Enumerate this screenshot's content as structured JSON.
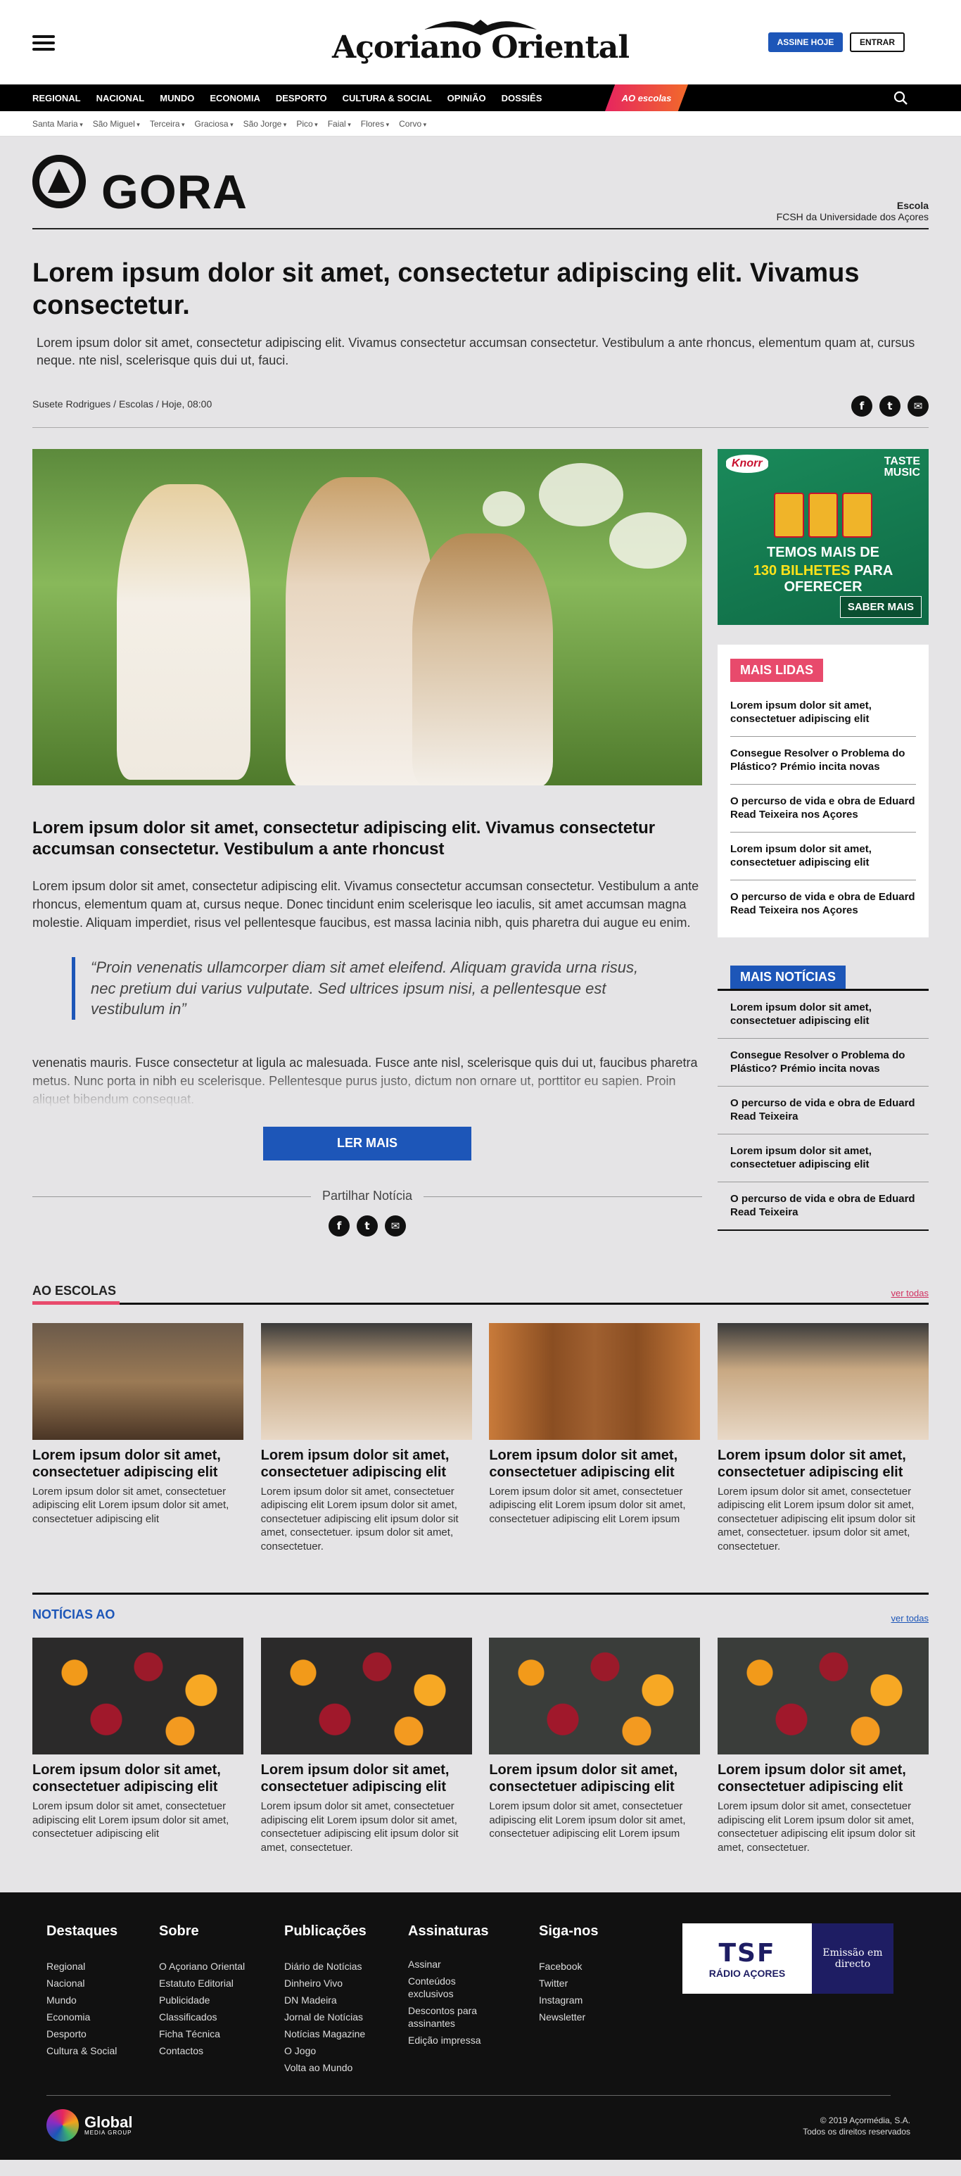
{
  "header": {
    "logo_text": "Açoriano Oriental",
    "subscribe_label": "ASSINE HOJE",
    "login_label": "ENTRAR"
  },
  "nav": {
    "items": [
      "REGIONAL",
      "NACIONAL",
      "MUNDO",
      "ECONOMIA",
      "DESPORTO",
      "CULTURA & SOCIAL",
      "OPINIÃO",
      "DOSSIÊS"
    ],
    "special": "AO escolas"
  },
  "subnav": {
    "items": [
      "Santa Maria",
      "São Miguel",
      "Terceira",
      "Graciosa",
      "São Jorge",
      "Pico",
      "Faial",
      "Flores",
      "Corvo"
    ]
  },
  "agora": {
    "wordmark": "GORA",
    "school_label": "Escola",
    "school_name": "FCSH da Universidade dos Açores"
  },
  "article": {
    "headline": "Lorem ipsum dolor sit amet, consectetur adipiscing elit. Vivamus consectetur.",
    "lead": "Lorem ipsum dolor sit amet, consectetur adipiscing elit. Vivamus consectetur accumsan consectetur. Vestibulum a ante rhoncus, elementum quam at, cursus neque. nte nisl, scelerisque quis dui ut, fauci.",
    "byline": "Susete Rodrigues / Escolas /  Hoje, 08:00",
    "subtitle": "Lorem ipsum dolor sit amet, consectetur adipiscing elit. Vivamus consectetur accumsan consectetur. Vestibulum a ante rhoncust",
    "body": "Lorem ipsum dolor sit amet, consectetur adipiscing elit. Vivamus consectetur accumsan consectetur. Vestibulum a ante rhoncus, elementum quam at, cursus neque. Donec tincidunt enim scelerisque leo iaculis, sit amet accumsan magna molestie. Aliquam imperdiet, risus vel pellentesque faucibus, est massa lacinia nibh, quis pharetra dui augue eu enim.",
    "quote": "“Proin venenatis ullamcorper diam sit amet eleifend. Aliquam gravida urna risus, nec pretium dui varius vulputate. Sed ultrices ipsum nisi, a pellentesque est vestibulum in”",
    "faded_body": "venenatis mauris. Fusce consectetur at ligula ac malesuada. Fusce ante nisl, scelerisque quis dui ut, faucibus pharetra metus. Nunc porta in nibh eu scelerisque. Pellentesque purus justo, dictum non ornare ut, porttitor eu sapien. Proin aliquet bibendum consequat.",
    "read_more": "LER MAIS",
    "share_label": "Partilhar Notícia"
  },
  "ad": {
    "brand": "Knorr",
    "tag_line1": "TASTE",
    "tag_line2": "MUSIC",
    "line1": "TEMOS MAIS DE",
    "line2_highlight": "130 BILHETES",
    "line2_rest": " PARA OFERECER",
    "cta": "SABER MAIS"
  },
  "mais_lidas": {
    "title": "MAIS LIDAS",
    "items": [
      "Lorem ipsum dolor sit amet, consectetuer adipiscing elit",
      "Consegue Resolver o Problema do Plástico? Prémio incita novas",
      "O percurso de vida e obra de Eduard Read Teixeira nos Açores",
      "Lorem ipsum dolor sit amet, consectetuer adipiscing elit",
      "O percurso de vida e obra de Eduard Read Teixeira nos Açores"
    ]
  },
  "mais_noticias": {
    "title": "MAIS NOTÍCIAS",
    "items": [
      "Lorem ipsum dolor sit amet, consectetuer adipiscing elit",
      "Consegue Resolver o Problema do Plástico? Prémio incita novas",
      "O percurso de vida e obra de Eduard Read Teixeira",
      "Lorem ipsum dolor sit amet, consectetuer adipiscing elit",
      "O percurso de vida e obra de Eduard Read Teixeira"
    ]
  },
  "ao_escolas": {
    "title": "AO ESCOLAS",
    "link": "ver todas",
    "cards": [
      {
        "title": "Lorem ipsum dolor sit amet, consectetuer adipiscing elit",
        "body": "Lorem ipsum dolor sit amet, consectetuer adipiscing elit Lorem ipsum dolor sit amet, consectetuer adipiscing elit"
      },
      {
        "title": "Lorem ipsum dolor sit amet, consectetuer adipiscing elit",
        "body": "Lorem ipsum dolor sit amet, consectetuer adipiscing elit Lorem ipsum dolor sit amet, consectetuer adipiscing elit ipsum dolor sit amet, consectetuer. ipsum dolor sit amet, consectetuer."
      },
      {
        "title": "Lorem ipsum dolor sit amet, consectetuer adipiscing elit",
        "body": "Lorem ipsum dolor sit amet, consectetuer adipiscing elit Lorem ipsum dolor sit amet, consectetuer adipiscing elit Lorem ipsum"
      },
      {
        "title": "Lorem ipsum dolor sit amet, consectetuer adipiscing elit",
        "body": "Lorem ipsum dolor sit amet, consectetuer adipiscing elit Lorem ipsum dolor sit amet, consectetuer adipiscing elit ipsum dolor sit amet, consectetuer. ipsum dolor sit amet, consectetuer."
      }
    ]
  },
  "noticias_ao": {
    "title": "NOTÍCIAS AO",
    "link": "ver todas",
    "cards": [
      {
        "title": "Lorem ipsum dolor sit amet, consectetuer adipiscing elit",
        "body": "Lorem ipsum dolor sit amet, consectetuer adipiscing elit Lorem ipsum dolor sit amet, consectetuer adipiscing elit"
      },
      {
        "title": "Lorem ipsum dolor sit amet, consectetuer adipiscing elit",
        "body": "Lorem ipsum dolor sit amet, consectetuer adipiscing elit Lorem ipsum dolor sit amet, consectetuer adipiscing elit ipsum dolor sit amet, consectetuer."
      },
      {
        "title": "Lorem ipsum dolor sit amet, consectetuer adipiscing elit",
        "body": "Lorem ipsum dolor sit amet, consectetuer adipiscing elit Lorem ipsum dolor sit amet, consectetuer adipiscing elit Lorem ipsum"
      },
      {
        "title": "Lorem ipsum dolor sit amet, consectetuer adipiscing elit",
        "body": "Lorem ipsum dolor sit amet, consectetuer adipiscing elit Lorem ipsum dolor sit amet, consectetuer adipiscing elit ipsum dolor sit amet, consectetuer."
      }
    ]
  },
  "footer": {
    "columns": [
      {
        "title": "Destaques",
        "links": [
          "Regional",
          "Nacional",
          "Mundo",
          "Economia",
          "Desporto",
          "Cultura & Social"
        ]
      },
      {
        "title": "Sobre",
        "links": [
          "O Açoriano Oriental",
          "Estatuto Editorial",
          "Publicidade",
          "Classificados",
          "Ficha Técnica",
          "Contactos"
        ]
      },
      {
        "title": "Publicações",
        "links": [
          "Diário de Notícias",
          "Dinheiro Vivo",
          "DN Madeira",
          "Jornal de Notícias",
          "Notícias Magazine",
          "O Jogo",
          "Volta ao Mundo"
        ]
      },
      {
        "title": "Assinaturas",
        "links": [
          "Assinar",
          "Conteúdos exclusivos",
          "Descontos para assinantes",
          "Edição impressa"
        ]
      },
      {
        "title": "Siga-nos",
        "links": [
          "Facebook",
          "Twitter",
          "Instagram",
          "Newsletter"
        ]
      }
    ],
    "radio_logo": "TSF",
    "radio_name": "RÁDIO AÇORES",
    "radio_live": "Emissão em directo",
    "group_name": "Global",
    "group_sub": "MEDIA GROUP",
    "copyright_line1": "© 2019 Açormédia, S.A.",
    "copyright_line2": "Todos os direitos reservados"
  },
  "colors": {
    "accent_blue": "#1d56b8",
    "accent_pink": "#e84a6c",
    "nav_bg": "#000000",
    "page_bg": "#e5e4e6",
    "footer_bg": "#111111"
  }
}
